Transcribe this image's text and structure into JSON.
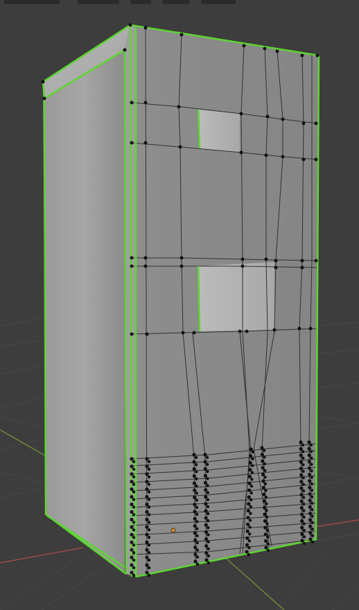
{
  "viewport": {
    "mode": "edit-mode",
    "background_color": "#3d3d3d",
    "grid_color": "#474747",
    "x_axis_color": "#9a4a4a",
    "y_axis_color": "#6f8a3a",
    "selection_color": "#5cd62f",
    "vertex_color": "#111111",
    "origin_color": "#e08a30"
  },
  "header": {
    "buttons": [
      "view-toggle",
      "shading-dropdown",
      "overlay-toggle",
      "xray-toggle",
      "solid-shading-button"
    ]
  },
  "mesh": {
    "name": "",
    "selected": true
  }
}
